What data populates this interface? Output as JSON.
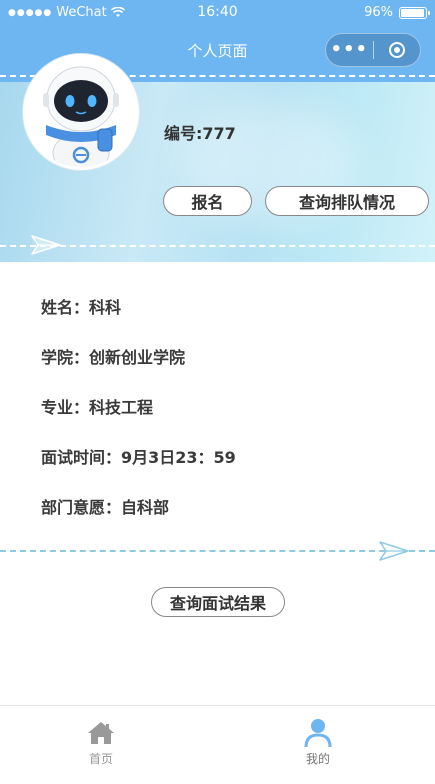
{
  "status_bar": {
    "carrier": "WeChat",
    "time": "16:40",
    "battery": "96%",
    "battery_level": 0.96
  },
  "nav": {
    "title": "个人页面",
    "more_icon": "more-dots-icon",
    "close_icon": "miniprogram-close-icon"
  },
  "profile": {
    "avatar": "robot-avatar",
    "id_text": "编号:777",
    "signup_label": "报名",
    "queue_label": "查询排队情况"
  },
  "info": {
    "name": "姓名：科科",
    "college": "学院：创新创业学院",
    "major": "专业：科技工程",
    "interview_time": "面试时间：9月3日23：59",
    "department": "部门意愿：自科部"
  },
  "result_button_label": "查询面试结果",
  "tabbar": {
    "home_label": "首页",
    "me_label": "我的",
    "active_color": "#6db6f2",
    "inactive_color": "#999999"
  }
}
